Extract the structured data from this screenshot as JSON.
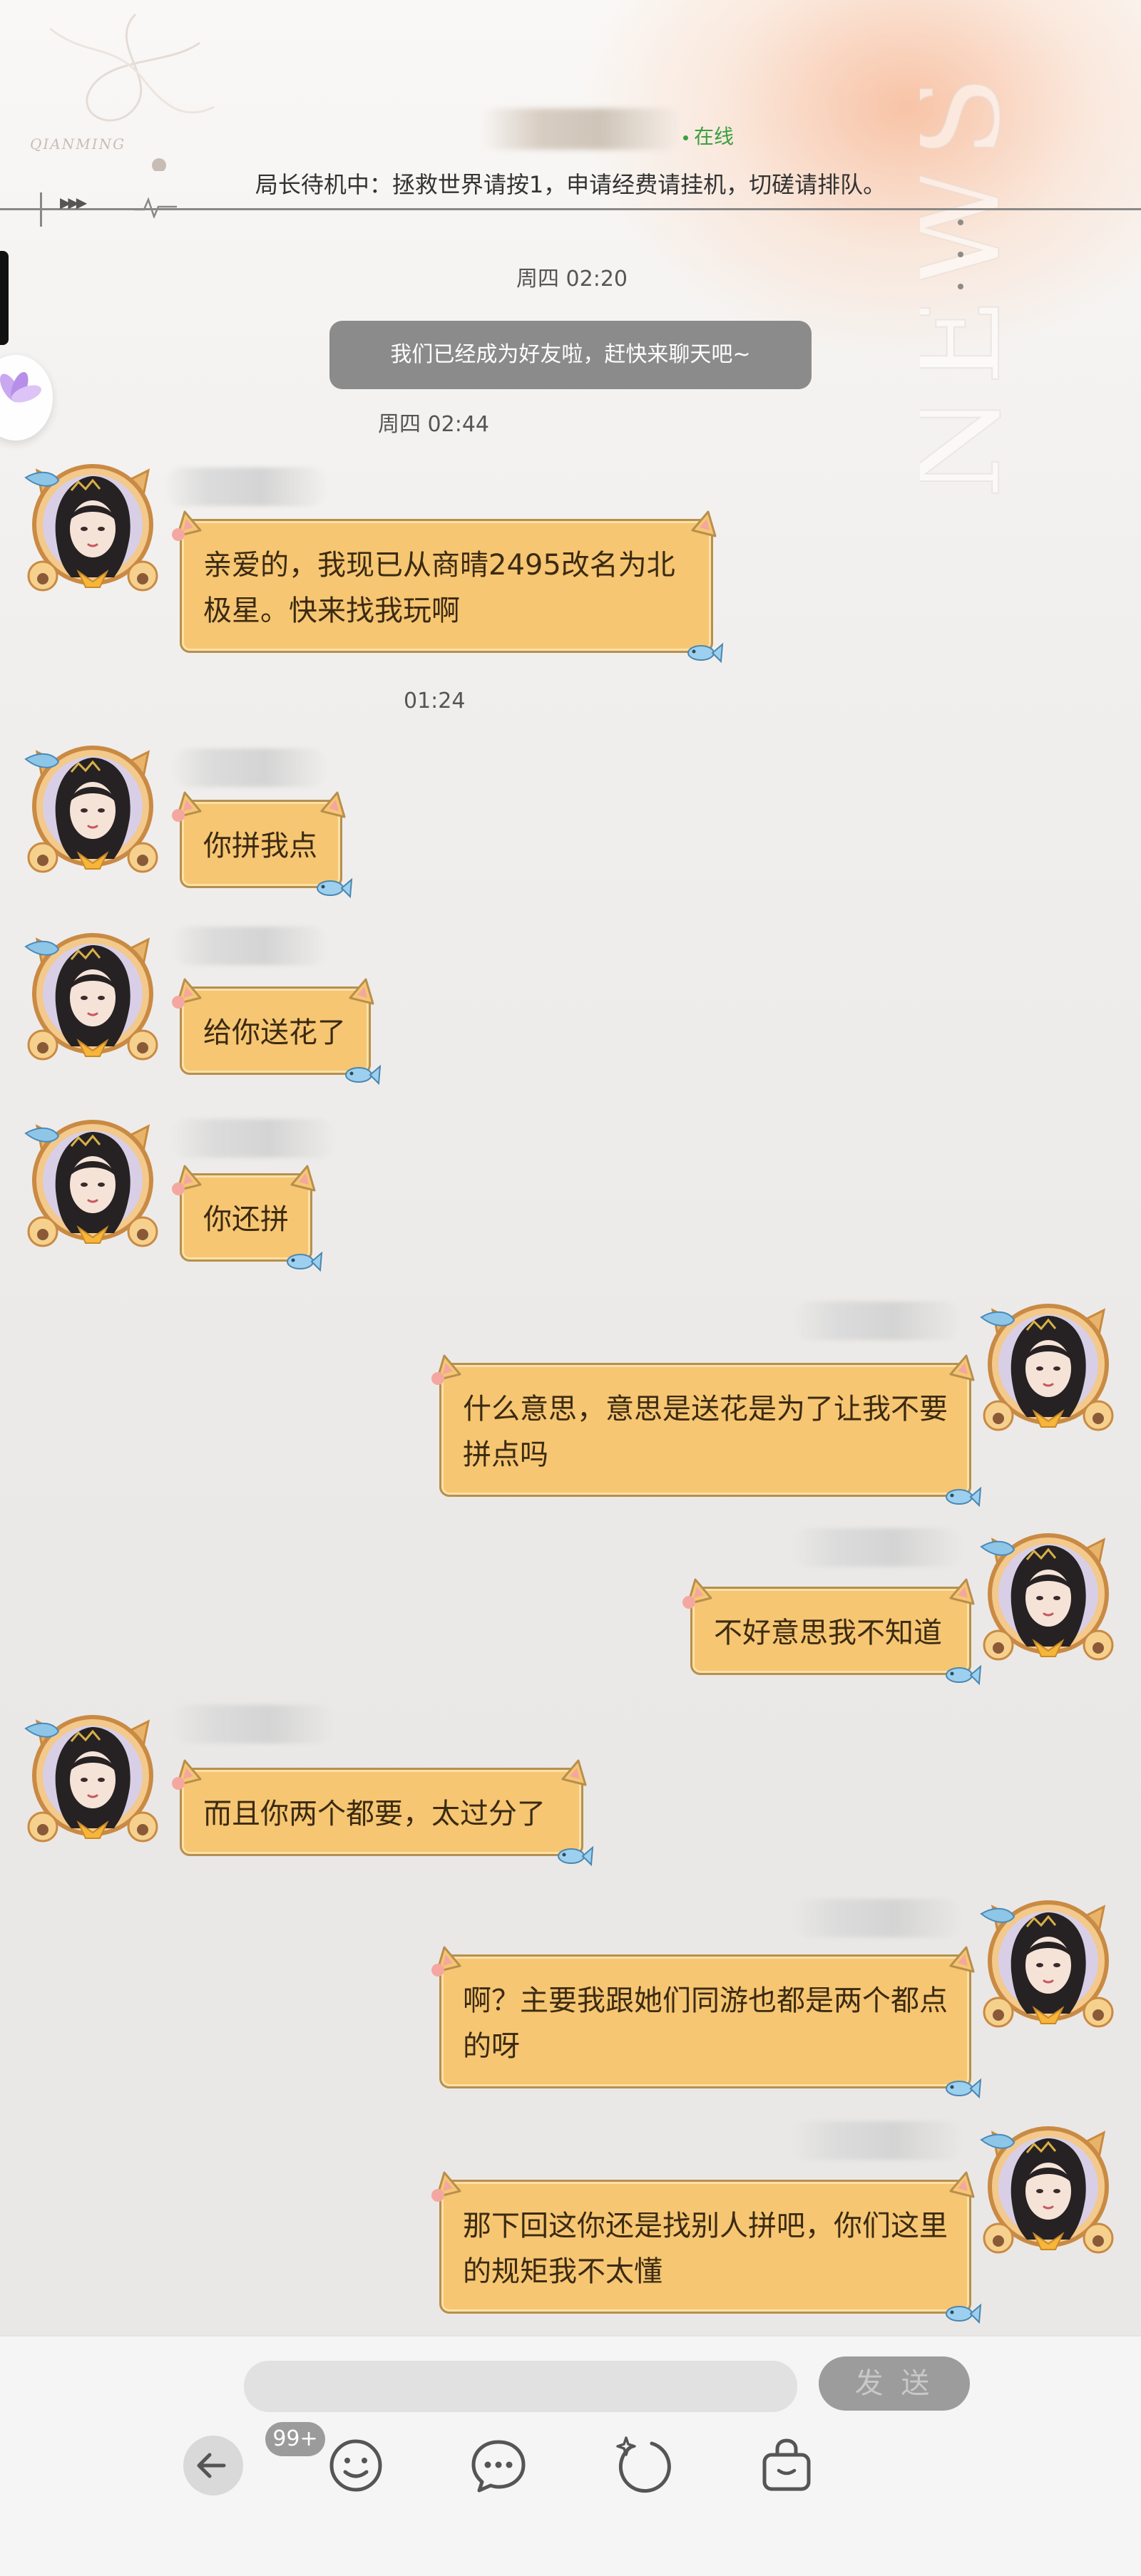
{
  "header": {
    "status": "在线",
    "signature": "局长待机中：拯救世界请按1，申请经费请挂机，切磋请排队。",
    "logo_text": "QIANMING",
    "side_text": "NEWS"
  },
  "messages": [
    {
      "type": "timestamp",
      "text": "周四 02:20"
    },
    {
      "type": "system",
      "text": "我们已经成为好友啦，赶快来聊天吧~"
    },
    {
      "type": "timestamp",
      "text": "周四 02:44"
    },
    {
      "type": "incoming",
      "text": "亲爱的，我现已从商晴2495改名为北极星。快来找我玩啊"
    },
    {
      "type": "timestamp",
      "text": "01:24"
    },
    {
      "type": "incoming",
      "text": "你拼我点"
    },
    {
      "type": "incoming",
      "text": "给你送花了"
    },
    {
      "type": "incoming",
      "text": "你还拼"
    },
    {
      "type": "outgoing",
      "text": "什么意思，意思是送花是为了让我不要拼点吗"
    },
    {
      "type": "outgoing",
      "text": "不好意思我不知道"
    },
    {
      "type": "incoming",
      "text": "而且你两个都要，太过分了"
    },
    {
      "type": "outgoing",
      "text": "啊？主要我跟她们同游也都是两个都点的呀"
    },
    {
      "type": "outgoing",
      "text": "那下回这你还是找别人拼吧，你们这里的规矩我不太懂"
    }
  ],
  "input": {
    "placeholder": "",
    "send_label": "发 送"
  },
  "toolbar": {
    "back_badge": "99+",
    "icons": [
      "back-arrow-icon",
      "emoji-icon",
      "chat-bubble-icon",
      "sparkle-ring-icon",
      "bag-icon"
    ]
  },
  "colors": {
    "bubble": "#f6c672",
    "bubble_border": "#b78f4e",
    "online": "#3aa040",
    "system_bubble": "#8b8b8b"
  }
}
